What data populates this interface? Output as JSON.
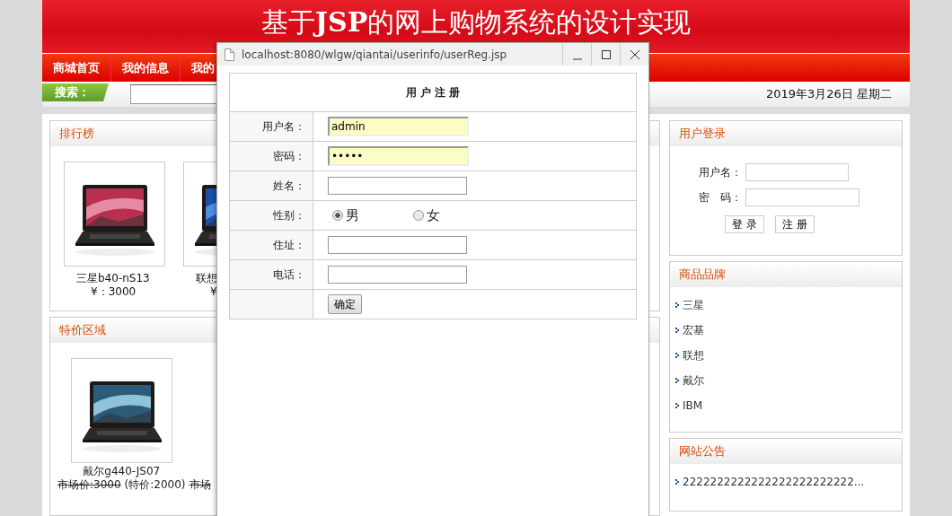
{
  "header": {
    "title": "基于**JSP**的网上购物系统的设计实现"
  },
  "nav": [
    {
      "label": "商城首页"
    },
    {
      "label": "我的信息"
    },
    {
      "label": "我的"
    }
  ],
  "search": {
    "label": "搜索："
  },
  "date": "2019年3月26日 星期二",
  "ranking": {
    "title": "排行榜",
    "items": [
      {
        "name": "三星b40-nS13",
        "price": "¥：3000"
      },
      {
        "name": "联想",
        "price": "¥"
      }
    ]
  },
  "specials": {
    "title": "特价区域",
    "items": [
      {
        "name": "戴尔g440-JS07",
        "market_price": "市场价:3000",
        "special_price": "(特价:2000)"
      },
      {
        "market_price": "市场"
      }
    ]
  },
  "login": {
    "title": "用户登录",
    "fields": [
      {
        "label": "用户名："
      },
      {
        "label": "密　码："
      }
    ],
    "buttons": [
      "登 录",
      "注 册"
    ]
  },
  "brands": {
    "title": "商品品牌",
    "items": [
      "三星",
      "宏基",
      "联想",
      "戴尔",
      "IBM"
    ]
  },
  "notices": {
    "title": "网站公告",
    "items": [
      "2222222222222222222222222..."
    ]
  },
  "dialog": {
    "url": "localhost:8080/wlgw/qiantai/userinfo/userReg.jsp",
    "heading": "用 户 注 册",
    "rows": [
      {
        "label": "用户名：",
        "kind": "text",
        "value": "admin",
        "highlighted": true
      },
      {
        "label": "密码：",
        "kind": "text",
        "value": "•••••",
        "highlighted": true
      },
      {
        "label": "姓名：",
        "kind": "text",
        "highlighted": false
      },
      {
        "label": "性别：",
        "kind": "radio",
        "options": [
          {
            "label": "男",
            "selected": true
          },
          {
            "label": "女",
            "selected": false
          }
        ]
      },
      {
        "label": "住址：",
        "kind": "text",
        "highlighted": false
      },
      {
        "label": "电话：",
        "kind": "text",
        "highlighted": false
      },
      {
        "kind": "button",
        "button": "确定"
      }
    ]
  }
}
